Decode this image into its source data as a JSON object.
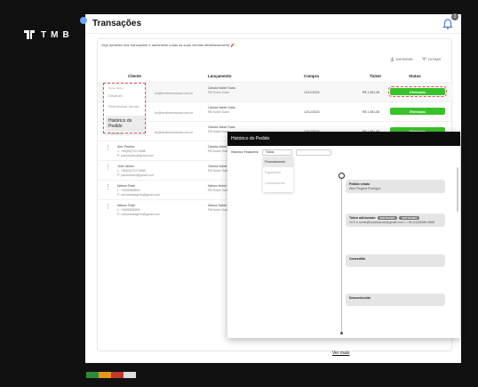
{
  "brand": {
    "name": "TMB"
  },
  "header": {
    "title": "Transações",
    "notification_count": "0"
  },
  "page": {
    "subtitle": "Veja detalhes das transações e administre todas as suas vendas detalhadamente 🧨",
    "actions": {
      "export": "EXPORTAR",
      "filter": "FILTRAR"
    }
  },
  "table": {
    "headers": [
      "Cliente",
      "Lançamento",
      "Compra",
      "Ticket",
      "Status"
    ],
    "rows": [
      {
        "name": "Nome Nome",
        "phone": "",
        "email": "ler@emailnexusnaw.com.br",
        "launch": "Cânula Nobel Gado",
        "launch_sub": "R$ Nobel Gado",
        "date": "12/12/2024",
        "ticket": "R$ 1.081,08",
        "status": "Efetivado"
      },
      {
        "name": "",
        "phone": "",
        "email": "ler@emailnexusnaw.com.br",
        "launch": "Cânula Nobel Gado",
        "launch_sub": "R$ Nobel Gado",
        "date": "12/12/2024",
        "ticket": "R$ 1.081,08",
        "status": "Efetivado"
      },
      {
        "name": "",
        "phone": "",
        "email": "ler@emailnexusnaw.com.br",
        "launch": "Cânula Nobel Gado",
        "launch_sub": "R$ Nobel Gado",
        "date": "12/12/2024",
        "ticket": "R$ 1.081,08",
        "status": "Efetivado"
      },
      {
        "name": "Alex Pereira",
        "phone": "L. +55(00)70174988",
        "email": "P: paulotadeo@gmail.com",
        "launch": "Cânula Nobel Gado",
        "launch_sub": "R$ Nobel Gado",
        "date": "",
        "ticket": "",
        "status": ""
      },
      {
        "name": "John James",
        "phone": "L. +55(00)70174988",
        "email": "P: paulotadeo@gmail.com",
        "launch": "Cânula Nobel Gado",
        "launch_sub": "R$ Nobel Gado",
        "date": "",
        "ticket": "",
        "status": ""
      },
      {
        "name": "Nelson Teste",
        "phone": "L. +5555555555",
        "email": "P: nelsonestagens@gmail.com",
        "launch": "Nelson Nobel",
        "launch_sub": "R$ Nobel Gado",
        "date": "",
        "ticket": "",
        "status": ""
      },
      {
        "name": "Nelson Teste",
        "phone": "L. +5555555555",
        "email": "P: nelsonestagens@gmail.com",
        "launch": "Nelson Nobel",
        "launch_sub": "R$ Nobel Gado",
        "date": "",
        "ticket": "",
        "status": ""
      }
    ]
  },
  "context_menu": {
    "header": "Nome Nome",
    "items": [
      "Detalhes",
      "Reembolsar Venda",
      "Histórico do Pedido",
      "Pendente"
    ]
  },
  "modal": {
    "title": "Histórico do Pedido",
    "filter_label": "Histórico Financeiro",
    "filter_value": "Todos",
    "dropdown_options": [
      "Financiamento",
      "Pagamento",
      "Cancelamento"
    ],
    "events": [
      {
        "label": "Pedido criado",
        "meta": "Átrio Pegaria Rodrigue"
      },
      {
        "label": "Token adicionado",
        "pill1": "EFETIVADO",
        "pill2": "EFETIVADO",
        "meta": "Or 5 n.nome@rodarkaeuxl@gmail.com L.+55 (11)98189-9966"
      },
      {
        "label": "Concedido",
        "meta": ""
      },
      {
        "label": "Desconhecido",
        "meta": ""
      }
    ]
  },
  "footer": {
    "more": "Ver mais"
  },
  "colors": {
    "status_green": "#39c22a",
    "swatches": [
      "#2e8b3a",
      "#e8941a",
      "#c0392b",
      "#dddddd"
    ]
  }
}
